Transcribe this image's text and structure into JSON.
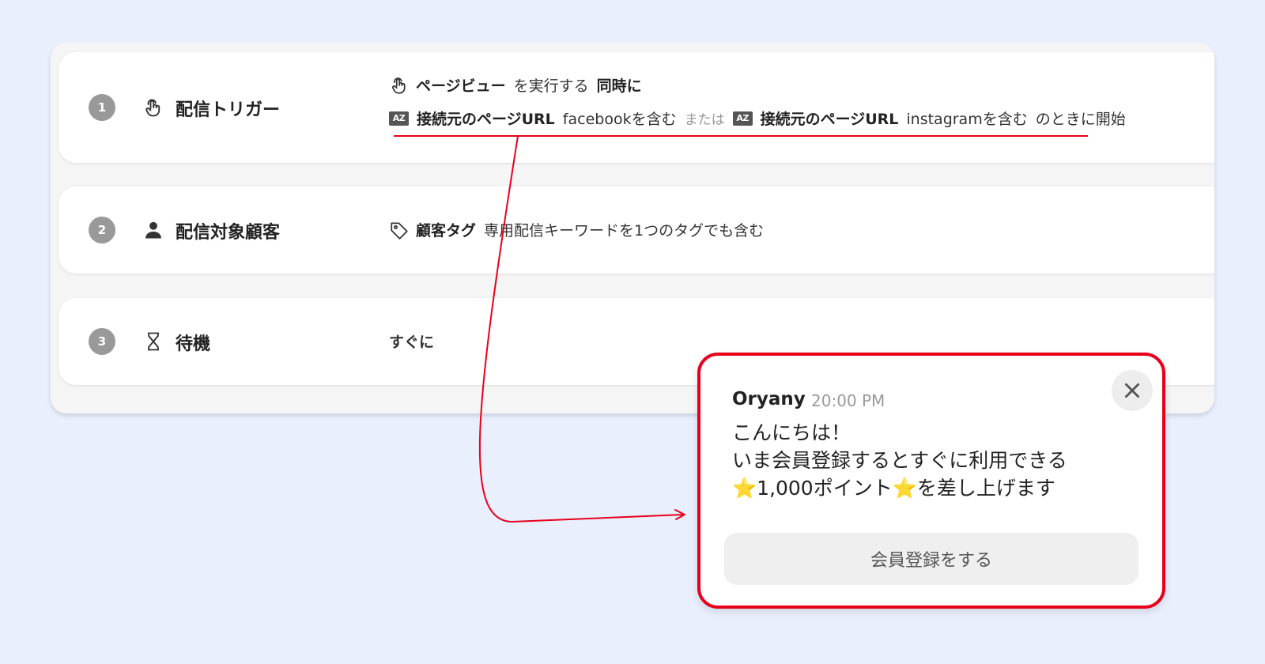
{
  "steps": [
    {
      "number": "1",
      "icon": "tap-icon",
      "title": "配信トリガー",
      "line1": {
        "event": "ページビュー",
        "verb": "を実行する",
        "timing": "同時に"
      },
      "line2": {
        "badge": "AZ",
        "cond1_field": "接続元のページURL",
        "cond1_value": "facebookを含む",
        "connector": "または",
        "cond2_field": "接続元のページURL",
        "cond2_value": "instagramを含む",
        "suffix": "のときに開始"
      }
    },
    {
      "number": "2",
      "icon": "person-icon",
      "title": "配信対象顧客",
      "tag_label": "顧客タグ",
      "tag_value": "専用配信キーワードを1つのタグでも含む"
    },
    {
      "number": "3",
      "icon": "hourglass-icon",
      "title": "待機",
      "value": "すぐに"
    }
  ],
  "popup": {
    "sender": "Oryany",
    "time": "20:00 PM",
    "body": [
      "こんにちは！",
      "いま会員登録するとすぐに利用できる",
      "⭐1,000ポイント⭐を差し上げます"
    ],
    "button": "会員登録をする"
  },
  "colors": {
    "accent": "#e8001b",
    "background": "#e9effd",
    "badge": "#999999"
  }
}
